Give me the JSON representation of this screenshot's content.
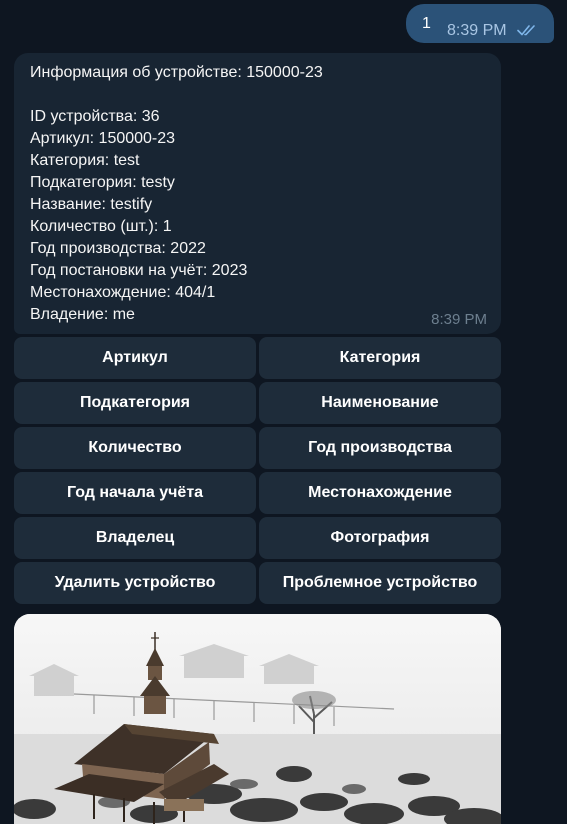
{
  "outgoing": {
    "text": "1",
    "time": "8:39 PM",
    "status_icon": "double-check-icon"
  },
  "incoming": {
    "lines": [
      "Информация об устройстве: 150000-23",
      "",
      "ID устройства: 36",
      "Артикул: 150000-23",
      "Категория: test",
      "Подкатегория: testy",
      "Название: testify",
      "Количество (шт.): 1",
      "Год производства: 2022",
      "Год постановки на учёт: 2023",
      "Местонахождение: 404/1",
      "Владение: me"
    ],
    "time": "8:39 PM"
  },
  "keyboard": {
    "buttons": [
      "Артикул",
      "Категория",
      "Подкатегория",
      "Наименование",
      "Количество",
      "Год производства",
      "Год начала учёта",
      "Местонахождение",
      "Владелец",
      "Фотография",
      "Удалить устройство",
      "Проблемное устройство"
    ]
  },
  "photo": {
    "description_icon": "landscape-photo"
  },
  "colors": {
    "background": "#0e1621",
    "outgoing_bubble": "#2b5278",
    "incoming_bubble": "#182533",
    "keyboard_button": "#1e2c3a",
    "check_color": "#7fb6ea"
  }
}
